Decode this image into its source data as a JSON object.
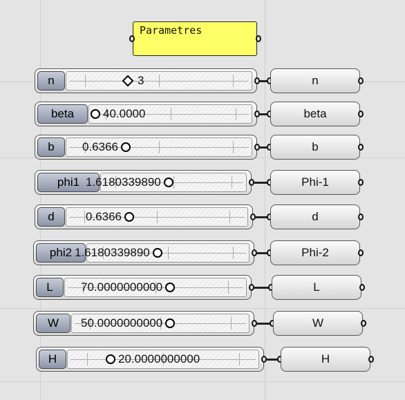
{
  "panel": {
    "text": "Parametres"
  },
  "sliders": [
    {
      "name": "n",
      "value": "3",
      "knob": "diamond"
    },
    {
      "name": "beta",
      "value": "40.0000",
      "knob": "circle"
    },
    {
      "name": "b",
      "value": "0.6366",
      "knob": "circle"
    },
    {
      "name": "phi1",
      "value": "1.6180339890",
      "knob": "circle"
    },
    {
      "name": "d",
      "value": "0.6366",
      "knob": "circle"
    },
    {
      "name": "phi2",
      "value": "1.6180339890",
      "knob": "circle"
    },
    {
      "name": "L",
      "value": "70.0000000000",
      "knob": "circle"
    },
    {
      "name": "W",
      "value": "50.0000000000",
      "knob": "circle"
    },
    {
      "name": "H",
      "value": "20.0000000000",
      "knob": "circle"
    }
  ],
  "params": [
    {
      "label": "n"
    },
    {
      "label": "beta"
    },
    {
      "label": "b"
    },
    {
      "label": "Phi-1"
    },
    {
      "label": "d"
    },
    {
      "label": "Phi-2"
    },
    {
      "label": "L"
    },
    {
      "label": "W"
    },
    {
      "label": "H"
    }
  ]
}
